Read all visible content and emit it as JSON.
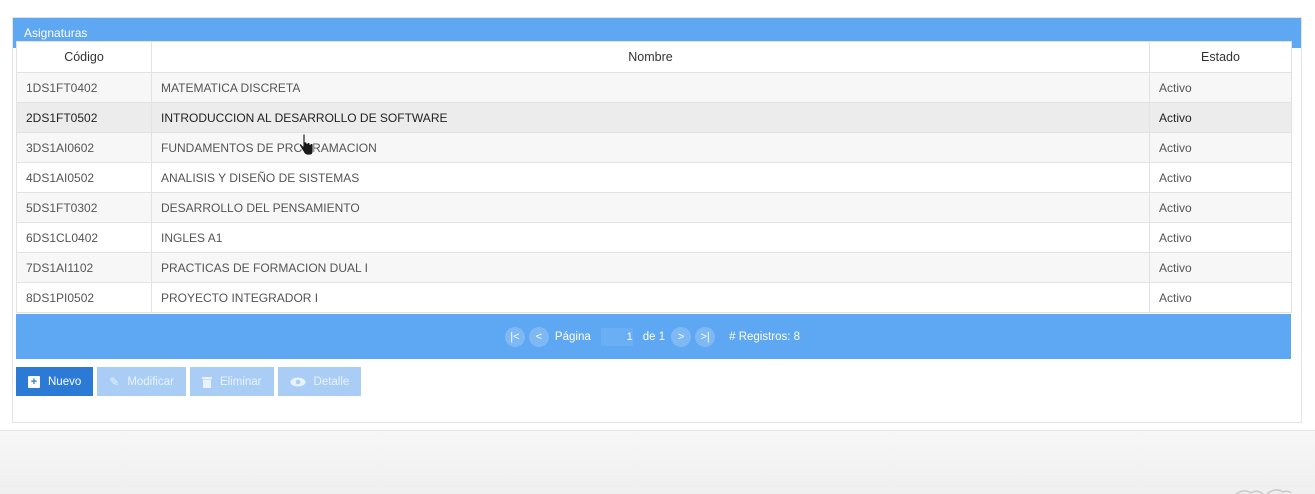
{
  "panel": {
    "title": "Asignaturas"
  },
  "table": {
    "columns": [
      "Código",
      "Nombre",
      "Estado"
    ],
    "rows": [
      {
        "codigo": "1DS1FT0402",
        "nombre": "MATEMATICA DISCRETA",
        "estado": "Activo"
      },
      {
        "codigo": "2DS1FT0502",
        "nombre": "INTRODUCCION AL DESARROLLO DE SOFTWARE",
        "estado": "Activo"
      },
      {
        "codigo": "3DS1AI0602",
        "nombre": "FUNDAMENTOS DE PROGRAMACION",
        "estado": "Activo"
      },
      {
        "codigo": "4DS1AI0502",
        "nombre": "ANALISIS Y DISEÑO DE SISTEMAS",
        "estado": "Activo"
      },
      {
        "codigo": "5DS1FT0302",
        "nombre": "DESARROLLO DEL PENSAMIENTO",
        "estado": "Activo"
      },
      {
        "codigo": "6DS1CL0402",
        "nombre": "INGLES A1",
        "estado": "Activo"
      },
      {
        "codigo": "7DS1AI1102",
        "nombre": "PRACTICAS DE FORMACION DUAL I",
        "estado": "Activo"
      },
      {
        "codigo": "8DS1PI0502",
        "nombre": "PROYECTO INTEGRADOR I",
        "estado": "Activo"
      }
    ]
  },
  "pager": {
    "first_icon": "first-page-icon",
    "prev_icon": "prev-page-icon",
    "page_label": "Página",
    "page_value": "1",
    "of_label": "de 1",
    "next_icon": "next-page-icon",
    "last_icon": "last-page-icon",
    "records_label": "# Registros: 8"
  },
  "toolbar": {
    "new_label": "Nuevo",
    "edit_label": "Modificar",
    "delete_label": "Eliminar",
    "detail_label": "Detalle"
  },
  "colors": {
    "header_blue": "#5ea7f3",
    "primary_button": "#2a7ad6",
    "disabled_button": "#a9cdf5"
  }
}
